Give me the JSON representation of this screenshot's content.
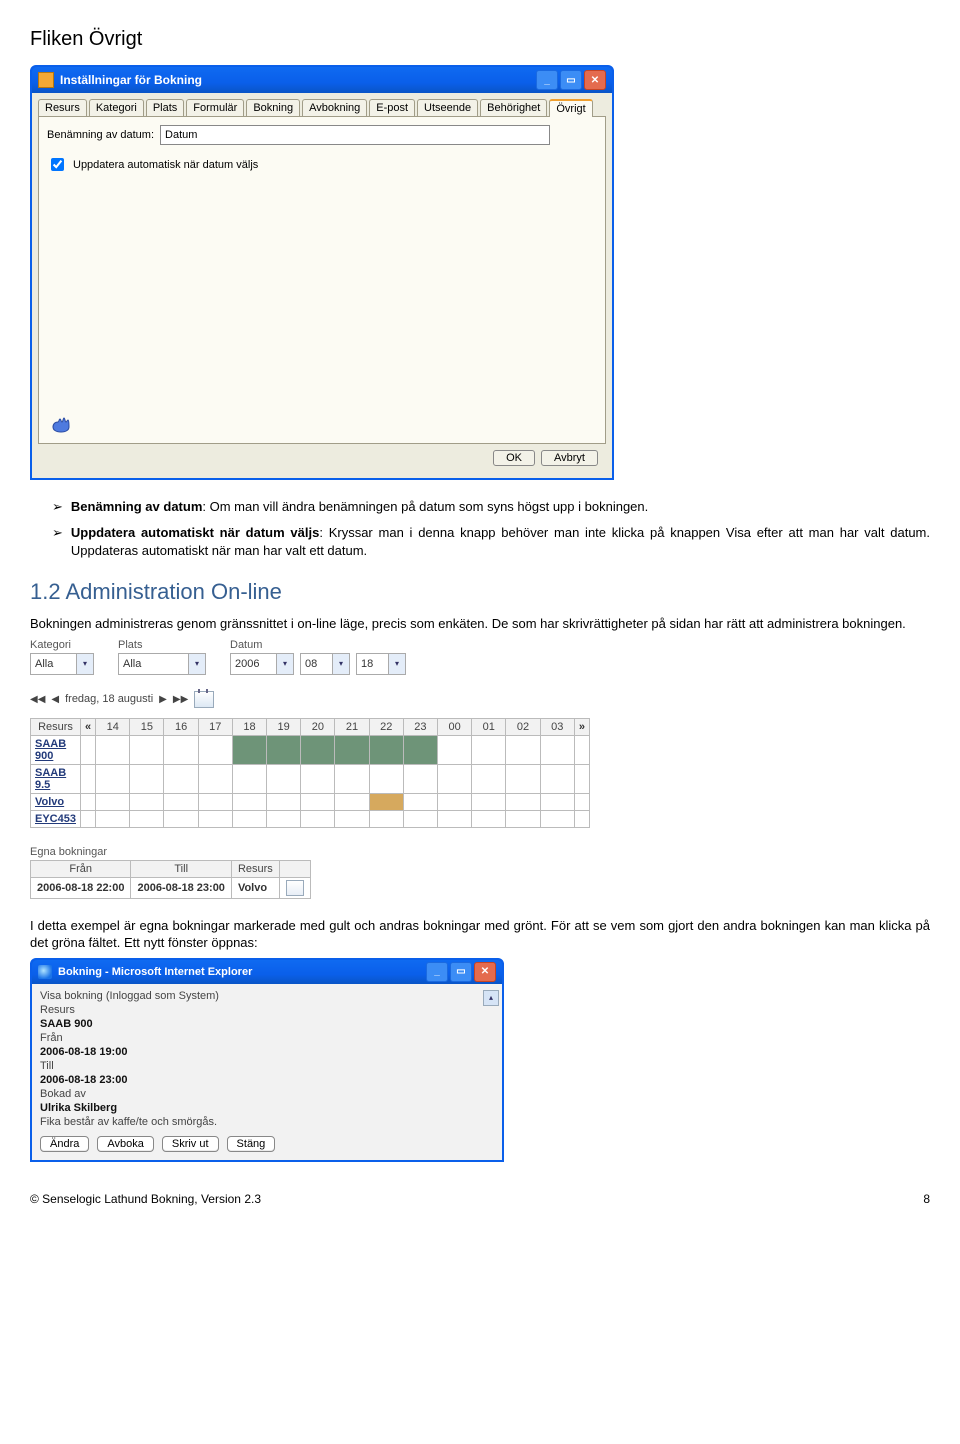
{
  "section_title": "Fliken Övrigt",
  "dialog": {
    "title": "Inställningar för Bokning",
    "tabs": [
      "Resurs",
      "Kategori",
      "Plats",
      "Formulär",
      "Bokning",
      "Avbokning",
      "E-post",
      "Utseende",
      "Behörighet",
      "Övrigt"
    ],
    "active_tab_idx": 9,
    "field_label": "Benämning av datum:",
    "field_value": "Datum",
    "checkbox_label": "Uppdatera automatisk när datum väljs",
    "checkbox_checked": true,
    "ok": "OK",
    "cancel": "Avbryt"
  },
  "bullets": [
    {
      "bold": "Benämning av datum",
      "sep": ":",
      "text": " Om man vill ändra benämningen på datum som syns högst upp i bokningen."
    },
    {
      "bold": "Uppdatera automatiskt när datum väljs",
      "sep": ":",
      "text": " Kryssar man i denna knapp behöver man inte klicka på knappen Visa efter att man har valt datum. Uppdateras automatiskt när man har valt ett datum."
    }
  ],
  "h2": "1.2 Administration On-line",
  "p_admin": "Bokningen administreras genom gränssnittet i on-line läge, precis som enkäten. De som har skrivrättigheter på sidan har rätt att administrera bokningen.",
  "booking": {
    "filters": {
      "kategori_label": "Kategori",
      "kategori_value": "Alla",
      "plats_label": "Plats",
      "plats_value": "Alla",
      "datum_label": "Datum",
      "year": "2006",
      "month": "08",
      "day": "18"
    },
    "daybar": {
      "label": "fredag, 18 augusti"
    },
    "header_resource": "Resurs",
    "hours": [
      "14",
      "15",
      "16",
      "17",
      "18",
      "19",
      "20",
      "21",
      "22",
      "23",
      "00",
      "01",
      "02",
      "03"
    ],
    "prev": "«",
    "next": "»",
    "resources": [
      "SAAB 900",
      "SAAB 9.5",
      "Volvo",
      "EYC453"
    ],
    "green_row_idx": 0,
    "green_cols": [
      4,
      5,
      6,
      7,
      8,
      9
    ],
    "yellow_row_idx": 2,
    "yellow_cols": [
      8
    ],
    "own_title": "Egna bokningar",
    "own_headers": [
      "Från",
      "Till",
      "Resurs",
      ""
    ],
    "own_row": [
      "2006-08-18 22:00",
      "2006-08-18 23:00",
      "Volvo"
    ]
  },
  "p_between": "I detta exempel är egna bokningar markerade med gult och andras bokningar med grönt. För att se vem som gjort den andra bokningen kan man klicka på det gröna fältet. Ett nytt fönster öppnas:",
  "popup": {
    "title": "Bokning - Microsoft Internet Explorer",
    "line_login": "Visa bokning (Inloggad som System)",
    "label_resurs": "Resurs",
    "val_resurs": "SAAB 900",
    "label_fran": "Från",
    "val_fran": "2006-08-18 19:00",
    "label_till": "Till",
    "val_till": "2006-08-18 23:00",
    "label_bokad": "Bokad av",
    "val_bokad": "Ulrika Skilberg",
    "note": "Fika består av kaffe/te och smörgås.",
    "buttons": [
      "Ändra",
      "Avboka",
      "Skriv ut",
      "Stäng"
    ]
  },
  "footer_left": "© Senselogic Lathund Bokning, Version 2.3",
  "footer_right": "8"
}
